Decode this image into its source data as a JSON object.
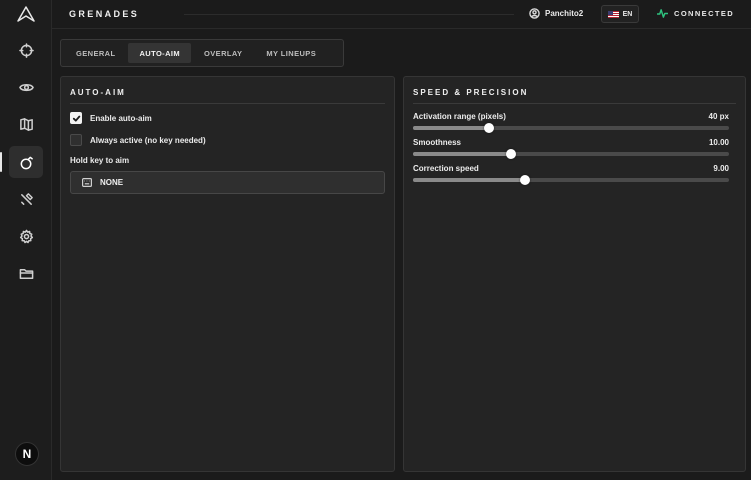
{
  "header": {
    "title": "GRENADES",
    "username": "Panchito2",
    "language": "EN",
    "status": "CONNECTED"
  },
  "sidebar": {
    "items": [
      {
        "icon": "crosshair-icon"
      },
      {
        "icon": "eye-icon"
      },
      {
        "icon": "map-icon"
      },
      {
        "icon": "grenade-icon",
        "active": true
      },
      {
        "icon": "tools-icon"
      },
      {
        "icon": "settings-icon"
      },
      {
        "icon": "folder-icon"
      }
    ],
    "badge": "N"
  },
  "tabs": [
    {
      "label": "GENERAL",
      "active": false
    },
    {
      "label": "AUTO-AIM",
      "active": true
    },
    {
      "label": "OVERLAY",
      "active": false
    },
    {
      "label": "MY LINEUPS",
      "active": false
    }
  ],
  "auto_aim": {
    "title": "AUTO-AIM",
    "enable_label": "Enable auto-aim",
    "enable_checked": true,
    "always_active_label": "Always active (no key needed)",
    "always_active_checked": false,
    "hold_key_label": "Hold key to aim",
    "hold_key_value": "NONE"
  },
  "speed_precision": {
    "title": "SPEED & PRECISION",
    "sliders": [
      {
        "label": "Activation range (pixels)",
        "value_text": "40 px",
        "fraction": 0.24
      },
      {
        "label": "Smoothness",
        "value_text": "10.00",
        "fraction": 0.31
      },
      {
        "label": "Correction speed",
        "value_text": "9.00",
        "fraction": 0.355
      }
    ]
  },
  "colors": {
    "accent_connected": "#2ec27e",
    "active_tab": "#343434"
  }
}
